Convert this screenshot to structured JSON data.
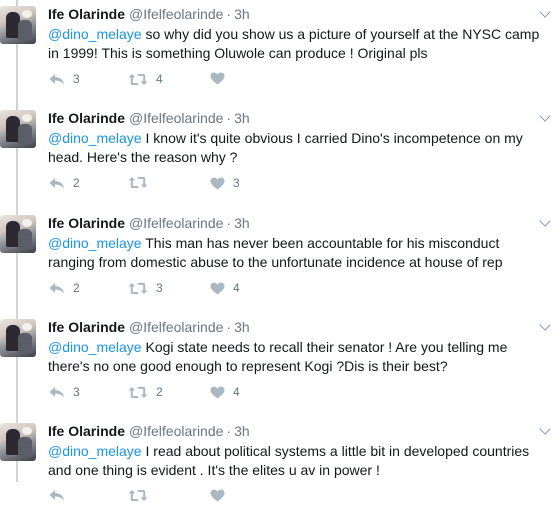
{
  "tweets": [
    {
      "name": "Ife Olarinde",
      "handle": "@Ifelfeolarinde",
      "time": "3h",
      "mention": "@dino_melaye",
      "text": " so why did you show us a picture of yourself at the NYSC camp in 1999! This is something Oluwole can produce ! Original pls",
      "replies": "3",
      "retweets": "4",
      "likes": ""
    },
    {
      "name": "Ife Olarinde",
      "handle": "@Ifelfeolarinde",
      "time": "3h",
      "mention": "@dino_melaye",
      "text": " I know it's quite obvious I carried Dino's incompetence on my head. Here's the reason why ?",
      "replies": "2",
      "retweets": "",
      "likes": "3"
    },
    {
      "name": "Ife Olarinde",
      "handle": "@Ifelfeolarinde",
      "time": "3h",
      "mention": "@dino_melaye",
      "text": " This man has never been accountable for his misconduct ranging from domestic abuse to the unfortunate incidence at house of rep",
      "replies": "2",
      "retweets": "3",
      "likes": "4"
    },
    {
      "name": "Ife Olarinde",
      "handle": "@Ifelfeolarinde",
      "time": "3h",
      "mention": "@dino_melaye",
      "text": " Kogi state needs to recall their senator ! Are you telling me there's no one good enough to represent Kogi ?Dis is their best?",
      "replies": "3",
      "retweets": "2",
      "likes": "4"
    },
    {
      "name": "Ife Olarinde",
      "handle": "@Ifelfeolarinde",
      "time": "3h",
      "mention": "@dino_melaye",
      "text": " I read about political systems a little bit in developed countries and one thing is evident . It's the elites u av in power !",
      "replies": "",
      "retweets": "",
      "likes": ""
    }
  ],
  "separator": "·",
  "icons": {
    "reply": "reply-icon",
    "retweet": "retweet-icon",
    "like": "heart-icon",
    "more": "chevron-down-icon"
  },
  "colors": {
    "link": "#1b95e0",
    "muted": "#657786",
    "thread_line": "#ccd6dd"
  }
}
